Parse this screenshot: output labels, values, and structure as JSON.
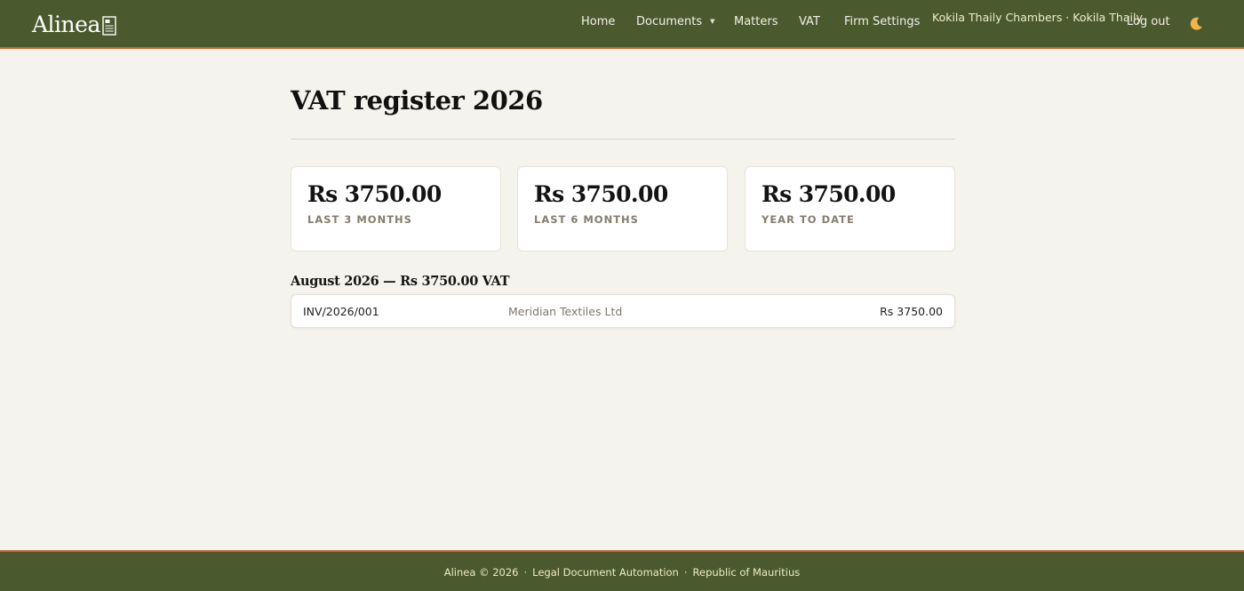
{
  "header": {
    "logo_text": "Alinea",
    "nav": [
      {
        "label": "Home"
      },
      {
        "label": "Documents"
      },
      {
        "label": "Matters"
      },
      {
        "label": "VAT"
      },
      {
        "label": "Firm Settings"
      }
    ],
    "user": "Kokila Thaily Chambers · Kokila Thaily",
    "logout_label": "Log out",
    "theme_icon": "moon-icon"
  },
  "main": {
    "title": "VAT register 2026",
    "stats": [
      {
        "value": "Rs 3750.00",
        "label": "Last 3 months"
      },
      {
        "value": "Rs 3750.00",
        "label": "Last 6 months"
      },
      {
        "value": "Rs 3750.00",
        "label": "Year to date"
      }
    ],
    "sections": [
      {
        "heading": "August 2026 — Rs 3750.00 VAT",
        "rows": [
          {
            "number": "INV/2026/001",
            "client": "Meridian Textiles Ltd",
            "amount": "Rs 3750.00"
          }
        ]
      }
    ]
  },
  "footer": {
    "copyright": "Alinea © 2026",
    "tagline": "Legal Document Automation",
    "country": "Republic of Mauritius"
  },
  "colors": {
    "header_bg": "#4a5a2e",
    "accent": "#c9682e",
    "page_bg": "#f5f3ee",
    "muted_label": "#857d70"
  }
}
